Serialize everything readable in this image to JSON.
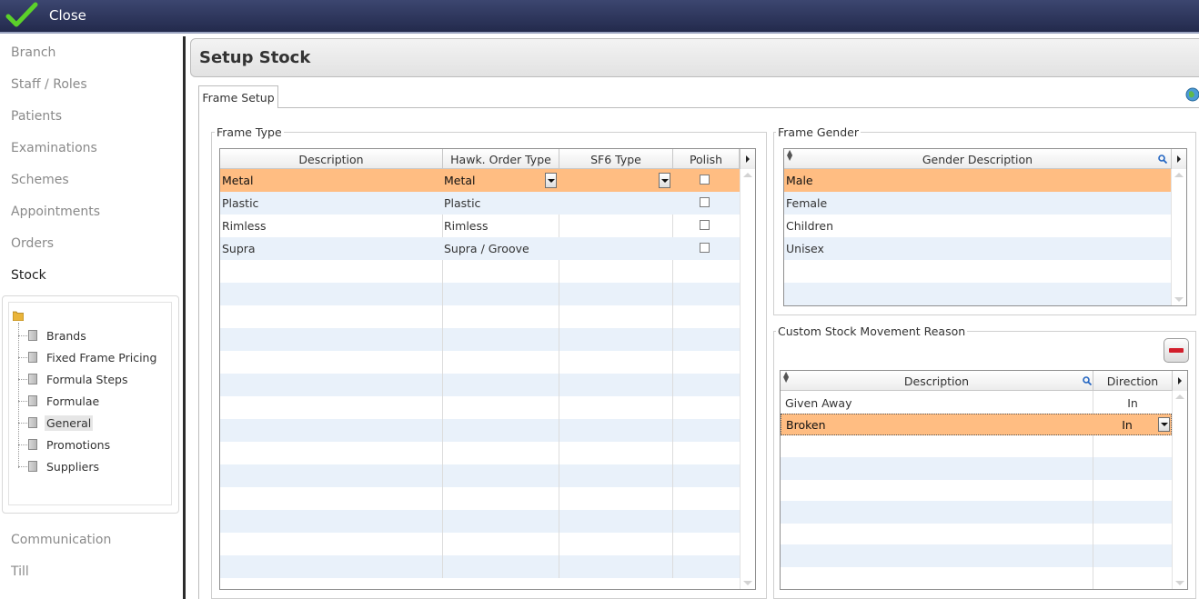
{
  "topbar": {
    "close_label": "Close",
    "close_icon": "checkmark-icon"
  },
  "sidebar": {
    "items": [
      "Branch",
      "Staff / Roles",
      "Patients",
      "Examinations",
      "Schemes",
      "Appointments",
      "Orders",
      "Stock",
      "Communication",
      "Till"
    ],
    "active_item": "Stock",
    "tree": {
      "items": [
        "Brands",
        "Fixed Frame Pricing",
        "Formula Steps",
        "Formulae",
        "General",
        "Promotions",
        "Suppliers"
      ],
      "selected": "General"
    }
  },
  "page": {
    "title": "Setup Stock",
    "tab": "Frame Setup"
  },
  "frame_type": {
    "group_title": "Frame Type",
    "columns": [
      "Description",
      "Hawk. Order Type",
      "SF6 Type",
      "Polish"
    ],
    "rows": [
      {
        "description": "Metal",
        "hawk_order_type": "Metal",
        "sf6_type": "",
        "polish": false
      },
      {
        "description": "Plastic",
        "hawk_order_type": "Plastic",
        "sf6_type": "",
        "polish": false
      },
      {
        "description": "Rimless",
        "hawk_order_type": "Rimless",
        "sf6_type": "",
        "polish": false
      },
      {
        "description": "Supra",
        "hawk_order_type": "Supra / Groove",
        "sf6_type": "",
        "polish": false
      }
    ]
  },
  "frame_gender": {
    "group_title": "Frame Gender",
    "column": "Gender Description",
    "rows": [
      "Male",
      "Female",
      "Children",
      "Unisex"
    ]
  },
  "custom_stock": {
    "group_title": "Custom Stock Movement Reason",
    "columns": [
      "Description",
      "Direction"
    ],
    "rows": [
      {
        "description": "Given Away",
        "direction": "In"
      },
      {
        "description": "Broken",
        "direction": "In"
      }
    ]
  },
  "colors": {
    "selected_row": "#ffbd82",
    "alt_row": "#e9f1fa",
    "topbar": "#2a3257",
    "remove": "#d21e2b"
  }
}
